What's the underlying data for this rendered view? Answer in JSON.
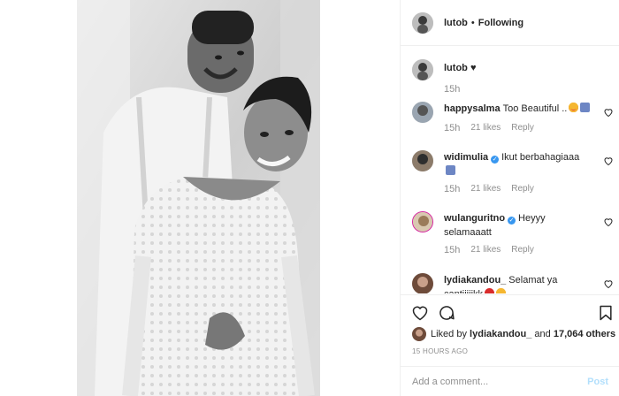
{
  "post": {
    "author": "lutob",
    "separator": "•",
    "follow_status": "Following"
  },
  "caption": {
    "username": "lutob",
    "text": "♥",
    "time": "15h"
  },
  "comments": [
    {
      "username": "happysalma",
      "verified": false,
      "text": "Too Beautiful ..",
      "time": "15h",
      "likes": "21 likes",
      "reply": "Reply"
    },
    {
      "username": "widimulia",
      "verified": true,
      "text": "Ikut berbahagiaaa",
      "time": "15h",
      "likes": "21 likes",
      "reply": "Reply"
    },
    {
      "username": "wulanguritno",
      "verified": true,
      "text": "Heyyy selamaaatt",
      "time": "15h",
      "likes": "21 likes",
      "reply": "Reply"
    },
    {
      "username": "lydiakandou_",
      "verified": false,
      "text": "Selamat ya cantiiiiikk",
      "time": "",
      "likes": "",
      "reply": ""
    }
  ],
  "likes": {
    "prefix": "Liked by",
    "user": "lydiakandou_",
    "middle": "and",
    "count": "17,064 others"
  },
  "timestamp": "15 HOURS AGO",
  "add_comment": {
    "placeholder": "Add a comment...",
    "post_label": "Post"
  },
  "icons": {
    "like": "heart-outline-icon",
    "comment": "comment-bubble-icon",
    "save": "bookmark-icon"
  },
  "colors": {
    "text": "#262626",
    "meta": "#8e8e8e",
    "verified": "#3897f0",
    "post_disabled": "#b2dffc",
    "border": "#efefef"
  }
}
